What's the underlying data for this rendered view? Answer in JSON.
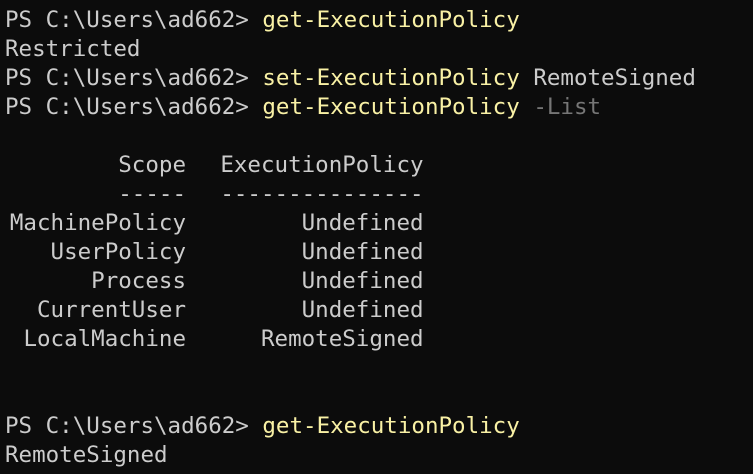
{
  "colors": {
    "background": "#0c0c0c",
    "foreground": "#cccccc",
    "command": "#f9f1a5",
    "parameter": "#767676"
  },
  "session": [
    {
      "prompt": "PS C:\\Users\\ad662> ",
      "command": "get-ExecutionPolicy",
      "argument": "",
      "parameter": ""
    },
    {
      "output": "Restricted"
    },
    {
      "prompt": "PS C:\\Users\\ad662> ",
      "command": "set-ExecutionPolicy",
      "argument": " RemoteSigned",
      "parameter": ""
    },
    {
      "prompt": "PS C:\\Users\\ad662> ",
      "command": "get-ExecutionPolicy",
      "argument": "",
      "parameter": " -List"
    }
  ],
  "policy_table": {
    "headers": {
      "scope": "Scope",
      "policy": "ExecutionPolicy"
    },
    "separators": {
      "scope": "-----",
      "policy": "---------------"
    },
    "rows": [
      {
        "scope": "MachinePolicy",
        "policy": "Undefined"
      },
      {
        "scope": "UserPolicy",
        "policy": "Undefined"
      },
      {
        "scope": "Process",
        "policy": "Undefined"
      },
      {
        "scope": "CurrentUser",
        "policy": "Undefined"
      },
      {
        "scope": "LocalMachine",
        "policy": "RemoteSigned"
      }
    ]
  },
  "final": {
    "prompt": "PS C:\\Users\\ad662> ",
    "command": "get-ExecutionPolicy",
    "output": "RemoteSigned"
  }
}
